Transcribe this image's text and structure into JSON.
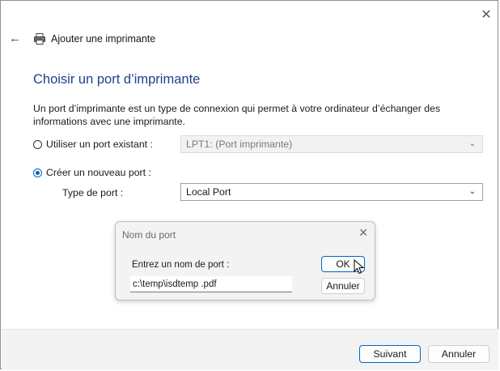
{
  "window": {
    "close_glyph": "✕"
  },
  "header": {
    "back_icon": "back-arrow-icon",
    "printer_icon": "printer-icon",
    "title": "Ajouter une imprimante"
  },
  "page": {
    "title": "Choisir un port d’imprimante",
    "description": "Un port d’imprimante est un type de connexion qui permet à votre ordinateur d’échanger des informations avec une imprimante."
  },
  "existing_port": {
    "label": "Utiliser un port existant :",
    "selected": false,
    "value": "LPT1: (Port imprimante)"
  },
  "new_port": {
    "label": "Créer un nouveau port :",
    "selected": true,
    "type_label": "Type de port :",
    "type_value": "Local Port"
  },
  "dialog": {
    "title": "Nom du port",
    "close_glyph": "✕",
    "prompt": "Entrez un nom de port :",
    "input_value": "c:\\temp\\isdtemp .pdf",
    "ok_label": "OK",
    "cancel_label": "Annuler"
  },
  "footer": {
    "next_label": "Suivant",
    "cancel_label": "Annuler"
  },
  "colors": {
    "accent": "#0067c0",
    "title": "#1f3f8c"
  }
}
